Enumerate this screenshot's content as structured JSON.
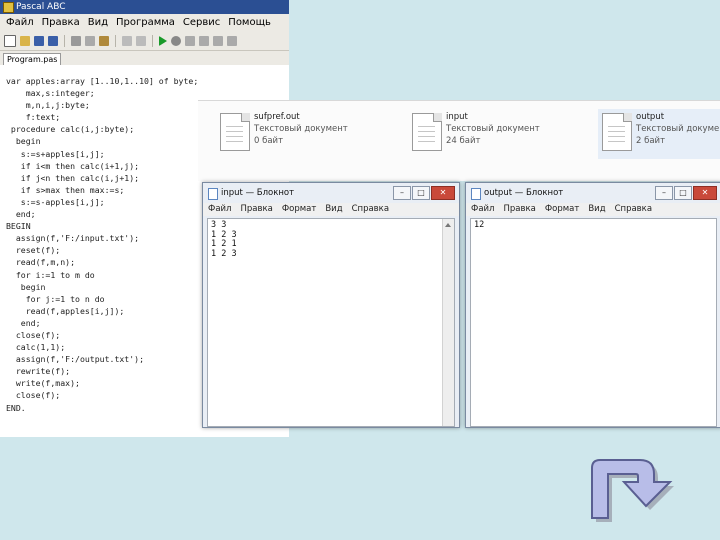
{
  "ide": {
    "title": "Pascal ABC",
    "menu": [
      "Файл",
      "Правка",
      "Вид",
      "Программа",
      "Сервис",
      "Помощь"
    ],
    "tab": "Program.pas",
    "code": [
      "var apples:array [1..10,1..10] of byte;",
      "    max,s:integer;",
      "    m,n,i,j:byte;",
      "    f:text;",
      " procedure calc(i,j:byte);",
      "  begin",
      "   s:=s+apples[i,j];",
      "   if i<m then calc(i+1,j);",
      "   if j<n then calc(i,j+1);",
      "   if s>max then max:=s;",
      "   s:=s-apples[i,j];",
      "  end;",
      "BEGIN",
      "  assign(f,'F:/input.txt');",
      "  reset(f);",
      "  read(f,m,n);",
      "  for i:=1 to m do",
      "   begin",
      "    for j:=1 to n do",
      "    read(f,apples[i,j]);",
      "   end;",
      "  close(f);",
      "  calc(1,1);",
      "  assign(f,'F:/output.txt');",
      "  rewrite(f);",
      "  write(f,max);",
      "  close(f);",
      "END."
    ]
  },
  "explorer": {
    "files": [
      {
        "name": "sufpref.out",
        "type": "Текстовый документ",
        "size": "0 байт"
      },
      {
        "name": "input",
        "type": "Текстовый документ",
        "size": "24 байт"
      },
      {
        "name": "output",
        "type": "Текстовый документ",
        "size": "2 байт"
      }
    ]
  },
  "notepad_input": {
    "title": "input — Блокнот",
    "menu": [
      "Файл",
      "Правка",
      "Формат",
      "Вид",
      "Справка"
    ],
    "content": "3 3\n1 2 3\n1 2 1\n1 2 3"
  },
  "notepad_output": {
    "title": "output — Блокнот",
    "menu": [
      "Файл",
      "Правка",
      "Формат",
      "Вид",
      "Справка"
    ],
    "content": "12"
  },
  "colors": {
    "background": "#cfe7ec",
    "ide_title": "#2b4f93",
    "return_arrow_fill": "#b8bde8",
    "return_arrow_stroke": "#5a5f92"
  },
  "icons": {
    "return": "return-arrow-icon"
  }
}
